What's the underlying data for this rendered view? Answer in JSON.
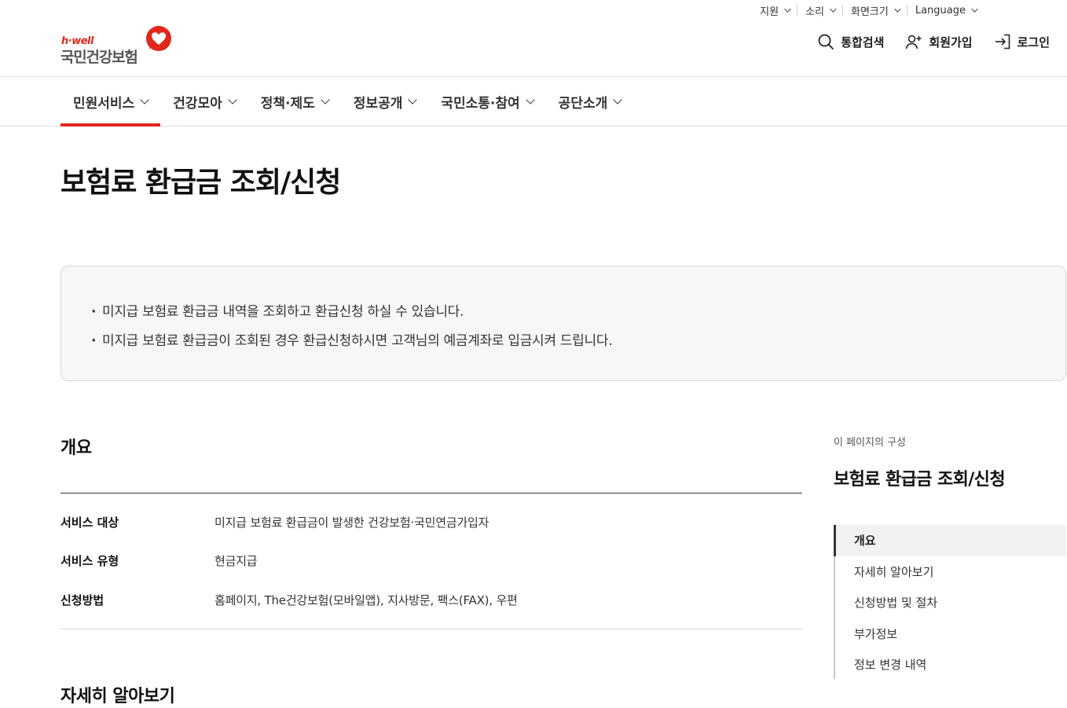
{
  "utility": {
    "support": "지원",
    "sound": "소리",
    "screen_size": "화면크기",
    "language": "Language"
  },
  "logo": {
    "tagline": "h·well",
    "name": "국민건강보험",
    "brand_color": "#e1261c"
  },
  "header_actions": {
    "search": "통합검색",
    "join": "회원가입",
    "login": "로그인"
  },
  "nav": {
    "items": [
      {
        "label": "민원서비스",
        "active": true
      },
      {
        "label": "건강모아",
        "active": false
      },
      {
        "label": "정책·제도",
        "active": false
      },
      {
        "label": "정보공개",
        "active": false
      },
      {
        "label": "국민소통·참여",
        "active": false
      },
      {
        "label": "공단소개",
        "active": false
      }
    ]
  },
  "page": {
    "title": "보험료 환급금 조회/신청"
  },
  "info": {
    "lines": [
      "미지급 보험료 환급금 내역을 조회하고 환급신청 하실 수 있습니다.",
      "미지급 보험료 환급금이 조회된 경우 환급신청하시면 고객님의 예금계좌로 입금시켜 드립니다."
    ]
  },
  "overview": {
    "heading": "개요",
    "rows": [
      {
        "label": "서비스 대상",
        "value": "미지급 보험료 환급금이 발생한 건강보험·국민연금가입자"
      },
      {
        "label": "서비스 유형",
        "value": "현금지급"
      },
      {
        "label": "신청방법",
        "value": "홈페이지, The건강보험(모바일앱), 지사방문, 팩스(FAX), 우편"
      }
    ]
  },
  "detail": {
    "heading": "자세히 알아보기"
  },
  "toc": {
    "caption": "이 페이지의 구성",
    "title": "보험료 환급금 조회/신청",
    "items": [
      {
        "label": "개요",
        "active": true
      },
      {
        "label": "자세히 알아보기",
        "active": false
      },
      {
        "label": "신청방법 및 절차",
        "active": false
      },
      {
        "label": "부가정보",
        "active": false
      },
      {
        "label": "정보 변경 내역",
        "active": false
      }
    ]
  }
}
